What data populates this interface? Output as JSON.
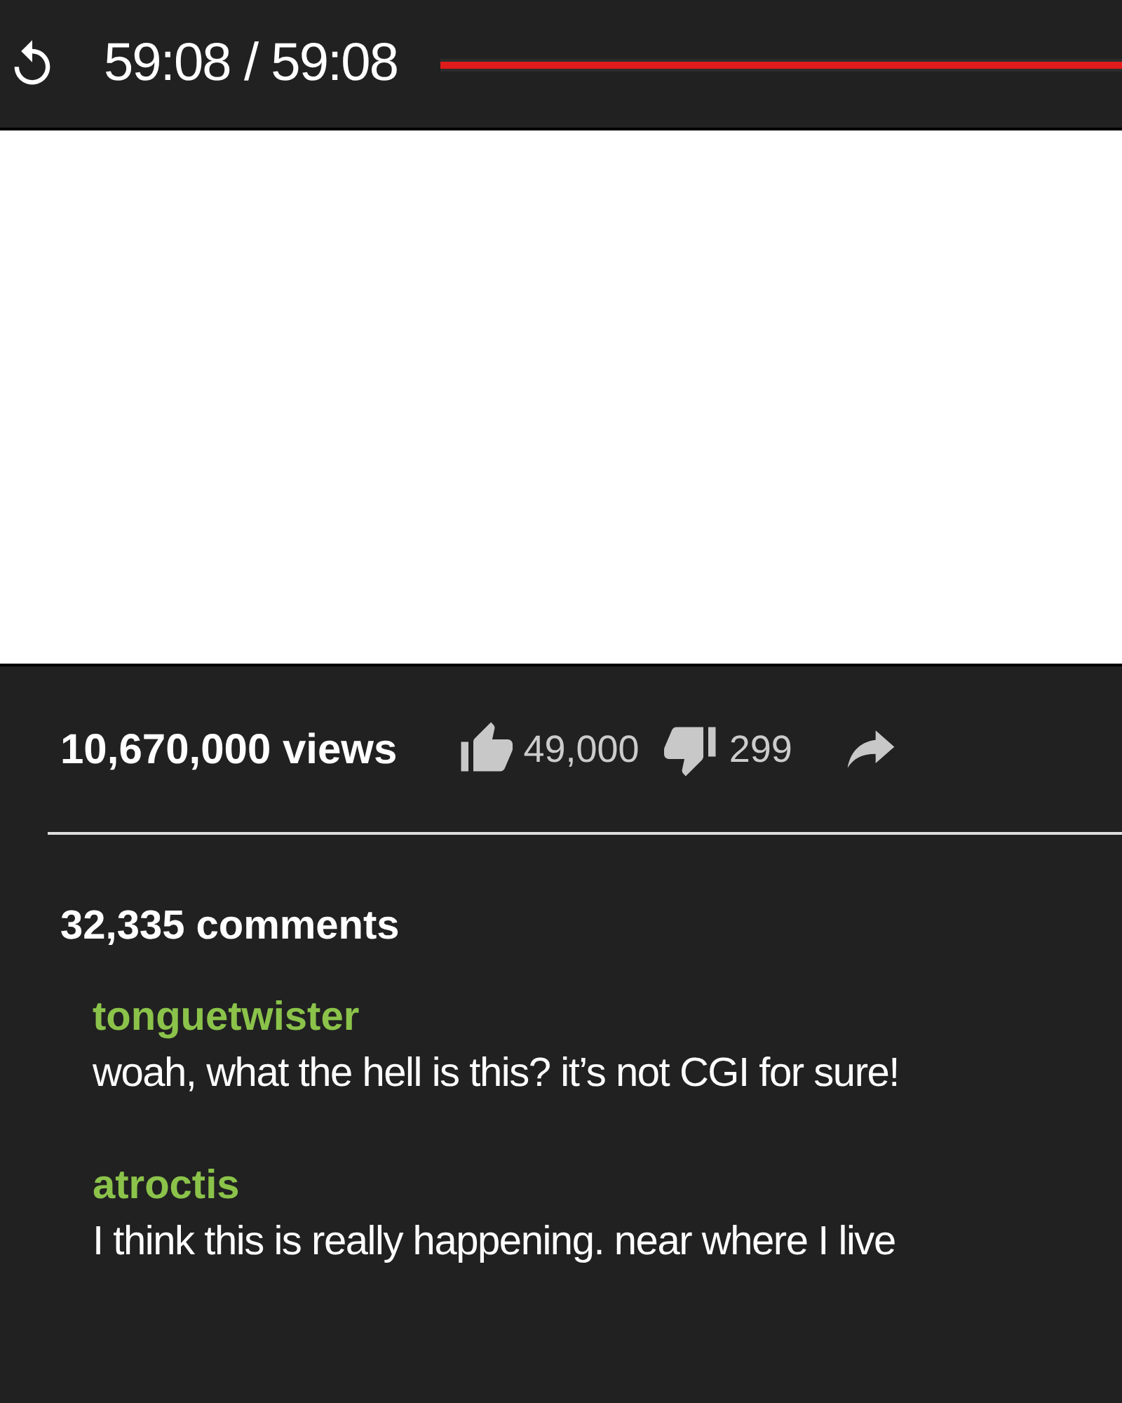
{
  "player": {
    "time": "59:08 / 59:08",
    "progress": {
      "level": 1
    }
  },
  "stats": {
    "views": "10,670,000 views",
    "likes": "49,000",
    "dislikes": "299"
  },
  "comments_count": "32,335 comments",
  "comments": [
    {
      "author": "tonguetwister",
      "text": "woah, what the hell is this? it’s not CGI for sure!"
    },
    {
      "author": "atroctis",
      "text": "I think this is really happening. near where I live"
    }
  ]
}
